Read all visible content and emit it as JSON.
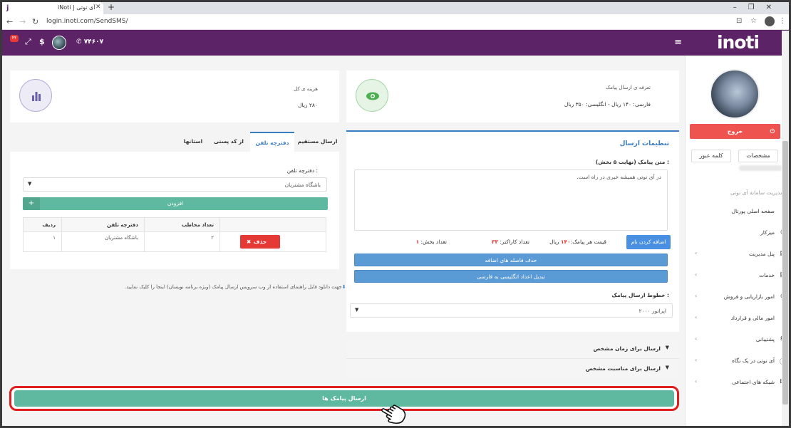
{
  "browser": {
    "tab_title": "iNoti | آی نوتی",
    "url": "login.inoti.com/SendSMS/"
  },
  "header": {
    "logo_text": "inoti",
    "badge": "۴۴",
    "phone": "۷۴۶۰۷"
  },
  "sidebar": {
    "logout_label": "خروج",
    "tab_profile": "مشخصات",
    "tab_password": "کلمه عبور",
    "section_title": "مدیریت سامانه آی نوتی",
    "items": [
      {
        "label": "صفحه اصلی پورتال"
      },
      {
        "label": "میزکار"
      },
      {
        "label": "پنل مدیریت"
      },
      {
        "label": "خدمات"
      },
      {
        "label": "امور بازاریابی و فروش"
      },
      {
        "label": "امور مالی و قرارداد"
      },
      {
        "label": "پشتیبانی"
      },
      {
        "label": "آی نوتی در یک نگاه"
      },
      {
        "label": "شبکه های اجتماعی"
      }
    ]
  },
  "tariff_card": {
    "title": "تعرفه ی ارسال پیامک",
    "value": "فارسی: ۱۴۰ ریال - انگلیسی: ۳۵۰ ریال"
  },
  "cost_card": {
    "title": "هزینه ی کل",
    "value": "۲۸۰ ریال"
  },
  "settings": {
    "title": "تنظیمات ارسال",
    "message_label": "متن پیامک (نهایت ۵ بخش) :",
    "message_text": "در آی نوتی همیشه خبری در راه است.",
    "add_name_button": "اضافه کردن نام",
    "price_label": "قیمت هر پیامک:",
    "price_value": "۱۴۰",
    "price_unit": "ریال",
    "chars_label": "تعداد کاراکتر:",
    "chars_value": "۳۳",
    "parts_label": "تعداد بخش:",
    "parts_value": "۱",
    "remove_spaces_button": "حذف فاصله های اضافه",
    "convert_digits_button": "تبدیل اعداد انگلیسی به فارسی",
    "line_label": "خطوط ارسال پیامک :",
    "line_value": "اپراتور ۲۰۰۰"
  },
  "collapse": {
    "schedule_label": "ارسال برای زمان مشخص",
    "occasion_label": "ارسال برای مناسبت مشخص"
  },
  "send_tabs": [
    {
      "label": "ارسال مستقیم"
    },
    {
      "label": "دفترچه تلفن"
    },
    {
      "label": "از کد پستی"
    },
    {
      "label": "استانها"
    }
  ],
  "phonebook": {
    "label": "دفترچه تلفن :",
    "select_value": "باشگاه مشتریان",
    "add_button": "افزودن",
    "columns": [
      "ردیف",
      "دفترچه تلفن",
      "تعداد مخاطب",
      ""
    ],
    "rows": [
      {
        "index": "۱",
        "name": "باشگاه مشتریان",
        "count": "۲",
        "action": "حذف"
      }
    ]
  },
  "download_note": "جهت دانلود فایل راهنمای استفاده از وب سرویس ارسال پیامک (ویژه برنامه نویسان) اینجا را کلیک نمایید.",
  "send_button": "ارسال پیامک ها"
}
